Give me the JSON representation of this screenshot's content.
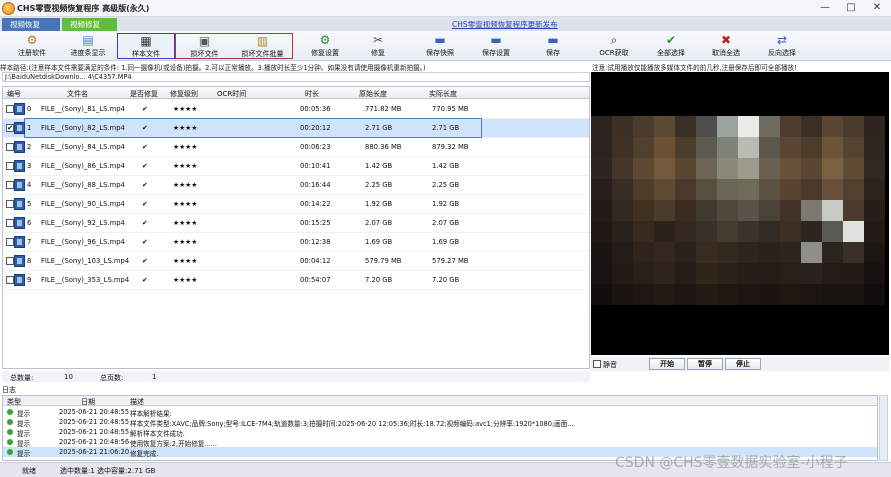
{
  "window": {
    "title": "CHS零壹视频恢复程序 高级版(永久)",
    "controls": [
      "—",
      "□",
      "✕"
    ]
  },
  "tabs": [
    {
      "label": "视频恢复"
    },
    {
      "label": "视频修复"
    }
  ],
  "top_link": "CHS零壹视频恢复程序更新发布",
  "toolbar": [
    {
      "label": "注册软件",
      "icon": "register-icon"
    },
    {
      "label": "进度条显示",
      "icon": "progress-icon"
    },
    {
      "label": "样本文件",
      "icon": "sample-file-icon"
    },
    {
      "label": "损坏文件",
      "icon": "bad-file-icon"
    },
    {
      "label": "损坏文件批量",
      "icon": "batch-file-icon"
    },
    {
      "label": "修复设置",
      "icon": "repair-settings-icon"
    },
    {
      "label": "修复",
      "icon": "repair-icon"
    },
    {
      "label": "保存快照",
      "icon": "snapshot-icon"
    },
    {
      "label": "保存设置",
      "icon": "save-settings-icon"
    },
    {
      "label": "保存",
      "icon": "save-icon"
    },
    {
      "label": "OCR获取",
      "icon": "ocr-icon"
    },
    {
      "label": "全部选择",
      "icon": "select-all-icon"
    },
    {
      "label": "取消全选",
      "icon": "deselect-all-icon"
    },
    {
      "label": "反向选择",
      "icon": "invert-select-icon"
    }
  ],
  "sample_path_label": "样本路径:(注意样本文件需要满足的条件: 1.同一摄像机(或设备)拍摄。2.可以正常播放。3.播放时长至少1分钟。如果没有请使用摄像机重新拍摄。)",
  "sample_path_value": "J:\\BaiduNetdiskDownlo...                           4\\C4357.MP4",
  "preview_notice": "注意:试用播放仅能播放多媒体文件的前几秒,注册保存后即可全部播放!",
  "grid": {
    "headers": [
      "编号",
      "文件名",
      "是否修复",
      "修复级别",
      "OCR时间",
      "时长",
      "原始长度",
      "实际长度"
    ],
    "rows": [
      {
        "num": "0",
        "name": "FILE__(Sony)_81_LS.mp4",
        "repaired": "✔",
        "level": "★★★★",
        "ocr": "",
        "duration": "00:05:36",
        "orig": "771.82 MB",
        "actual": "770.95 MB",
        "checked": ""
      },
      {
        "num": "1",
        "name": "FILE__(Sony)_82_LS.mp4",
        "repaired": "✔",
        "level": "★★★★",
        "ocr": "",
        "duration": "00:20:12",
        "orig": "2.71 GB",
        "actual": "2.71 GB",
        "checked": "✔"
      },
      {
        "num": "2",
        "name": "FILE__(Sony)_84_LS.mp4",
        "repaired": "✔",
        "level": "★★★★",
        "ocr": "",
        "duration": "00:06:23",
        "orig": "880.36 MB",
        "actual": "879.32 MB",
        "checked": ""
      },
      {
        "num": "3",
        "name": "FILE__(Sony)_86_LS.mp4",
        "repaired": "✔",
        "level": "★★★★",
        "ocr": "",
        "duration": "00:10:41",
        "orig": "1.42 GB",
        "actual": "1.42 GB",
        "checked": ""
      },
      {
        "num": "4",
        "name": "FILE__(Sony)_88_LS.mp4",
        "repaired": "✔",
        "level": "★★★★",
        "ocr": "",
        "duration": "00:16:44",
        "orig": "2.25 GB",
        "actual": "2.25 GB",
        "checked": ""
      },
      {
        "num": "5",
        "name": "FILE__(Sony)_90_LS.mp4",
        "repaired": "✔",
        "level": "★★★★",
        "ocr": "",
        "duration": "00:14:22",
        "orig": "1.92 GB",
        "actual": "1.92 GB",
        "checked": ""
      },
      {
        "num": "6",
        "name": "FILE__(Sony)_92_LS.mp4",
        "repaired": "✔",
        "level": "★★★★",
        "ocr": "",
        "duration": "00:15:25",
        "orig": "2.07 GB",
        "actual": "2.07 GB",
        "checked": ""
      },
      {
        "num": "7",
        "name": "FILE__(Sony)_96_LS.mp4",
        "repaired": "✔",
        "level": "★★★★",
        "ocr": "",
        "duration": "00:12:38",
        "orig": "1.69 GB",
        "actual": "1.69 GB",
        "checked": ""
      },
      {
        "num": "8",
        "name": "FILE__(Sony)_103_LS.mp4",
        "repaired": "✔",
        "level": "★★★★",
        "ocr": "",
        "duration": "00:04:12",
        "orig": "579.79 MB",
        "actual": "579.27 MB",
        "checked": ""
      },
      {
        "num": "9",
        "name": "FILE__(Sony)_353_LS.mp4",
        "repaired": "✔",
        "level": "★★★★",
        "ocr": "",
        "duration": "00:54:07",
        "orig": "7.20 GB",
        "actual": "7.20 GB",
        "checked": ""
      }
    ],
    "selected_index": 1
  },
  "summary": {
    "total_label": "总数量:",
    "total_value": "10",
    "pages_label": "总页数:",
    "pages_value": "1"
  },
  "player": {
    "mute_label": "静音",
    "play_label": "开始",
    "pause_label": "暂停",
    "stop_label": "停止"
  },
  "log": {
    "title": "日志",
    "headers": [
      "类型",
      "日期",
      "描述"
    ],
    "rows": [
      {
        "type": "提示",
        "date": "2025-06-21 20:48:55",
        "desc": "样本解析结果:"
      },
      {
        "type": "提示",
        "date": "2025-06-21 20:48:55",
        "desc": "样本文件类型:XAVC;品牌:Sony;型号:ILCE-7M4;轨道数量:3;拍摄时间:2025-06-20 12:05:36;时长:18.72;视频编码:avc1;分辨率:1920*1080;画面..."
      },
      {
        "type": "提示",
        "date": "2025-06-21 20:48:55",
        "desc": "解析样本文件成功."
      },
      {
        "type": "提示",
        "date": "2025-06-21 20:48:56",
        "desc": "使用恢复方案:2,开始修复......"
      },
      {
        "type": "提示",
        "date": "2025-06-21 21:06:20",
        "desc": "修复完成."
      }
    ]
  },
  "status": {
    "ready": "就绪",
    "selection": "选中数量:1 选中容量:2.71 GB",
    "watermark": "CSDN @CHS零壹数据实验室-小程子"
  },
  "colors": {
    "tab_recover": "#4a74b8",
    "tab_repair": "#5fbf3a",
    "selected_row": "#cfe3fb",
    "highlight_box_blue": "#3a3ad0",
    "highlight_box_red": "#c0303c"
  }
}
